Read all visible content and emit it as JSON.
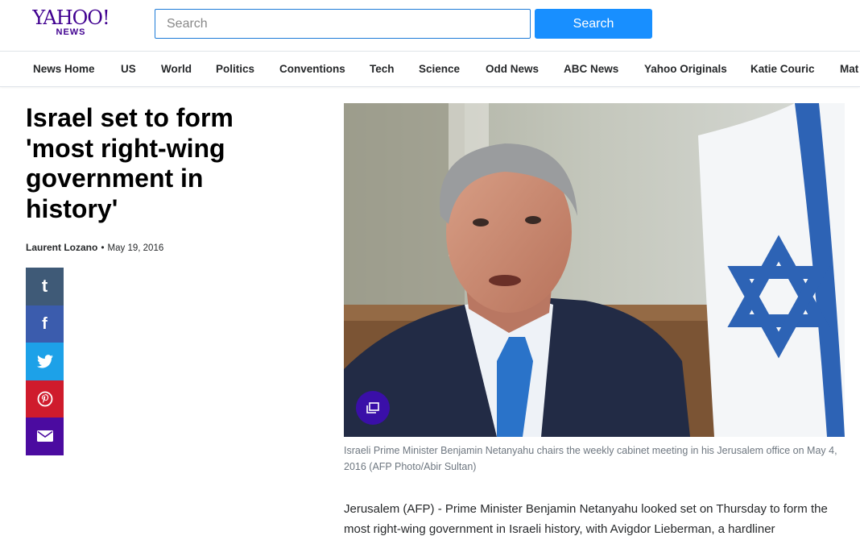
{
  "header": {
    "logo_main": "YAHOO!",
    "logo_sub": "NEWS",
    "search_placeholder": "Search",
    "search_button": "Search"
  },
  "nav": {
    "items": [
      "News Home",
      "US",
      "World",
      "Politics",
      "Conventions",
      "Tech",
      "Science",
      "Odd News",
      "ABC News",
      "Yahoo Originals",
      "Katie Couric",
      "Mat"
    ]
  },
  "article": {
    "headline": "Israel set to form 'most right-wing government in history'",
    "author": "Laurent Lozano",
    "separator": "•",
    "date": "May 19, 2016",
    "caption": "Israeli Prime Minister Benjamin Netanyahu chairs the weekly cabinet meeting in his Jerusalem office on May 4, 2016 (AFP Photo/Abir Sultan)",
    "body": "Jerusalem (AFP) - Prime Minister Benjamin Netanyahu looked set on Thursday to form the most right-wing government in Israeli history, with Avigdor Lieberman, a hardliner"
  },
  "share": {
    "buttons": [
      {
        "name": "tumblr",
        "glyph": "t"
      },
      {
        "name": "facebook",
        "glyph": "f"
      },
      {
        "name": "twitter",
        "icon": "twitter-bird-icon"
      },
      {
        "name": "pinterest",
        "icon": "pinterest-icon"
      },
      {
        "name": "mail",
        "icon": "envelope-icon"
      }
    ]
  },
  "colors": {
    "brand": "#400090",
    "search_button": "#188fff",
    "tumblr": "#3f5a77",
    "facebook": "#3b5cad",
    "twitter": "#1da1e8",
    "pinterest": "#cf1b2c",
    "mail": "#4b0ba0"
  }
}
